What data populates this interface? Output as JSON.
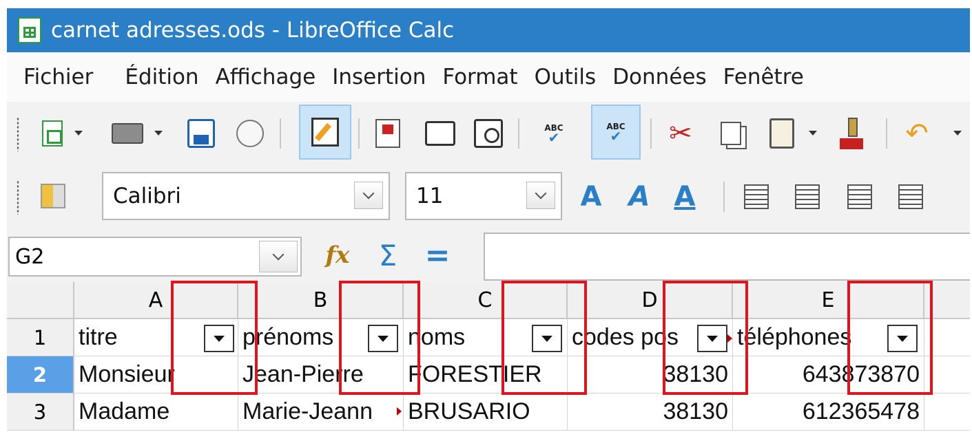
{
  "window": {
    "title": "carnet adresses.ods - LibreOffice Calc",
    "app_icon": "calc-document-icon"
  },
  "menu": [
    "Fichier",
    "Édition",
    "Affichage",
    "Insertion",
    "Format",
    "Outils",
    "Données",
    "Fenêtre"
  ],
  "standard_toolbar": {
    "icons": [
      "new-icon",
      "open-icon",
      "save-icon",
      "email-icon",
      "edit-mode-icon",
      "export-pdf-icon",
      "print-icon",
      "print-preview-icon",
      "spellcheck-icon",
      "autospellcheck-icon",
      "cut-icon",
      "copy-icon",
      "paste-icon",
      "clone-formatting-icon",
      "undo-icon"
    ]
  },
  "formatting_toolbar": {
    "font_name": "Calibri",
    "font_size": "11",
    "icons": [
      "styles-icon",
      "bold-icon",
      "italic-icon",
      "underline-icon",
      "align-left-icon",
      "align-center-icon",
      "align-right-icon",
      "justify-icon"
    ]
  },
  "formula_bar": {
    "cell_ref": "G2",
    "content": "",
    "icons": [
      "function-wizard-icon",
      "sum-icon",
      "equals-icon"
    ]
  },
  "sheet": {
    "columns": [
      "A",
      "B",
      "C",
      "D",
      "E"
    ],
    "rows": [
      {
        "num": "1",
        "cells": [
          "titre",
          "prénoms",
          "noms",
          "codes pos",
          "téléphones"
        ]
      },
      {
        "num": "2",
        "cells": [
          "Monsieur",
          "Jean-Pierre",
          "FORESTIER",
          "38130",
          "643873870"
        ]
      },
      {
        "num": "3",
        "cells": [
          "Madame",
          "Marie-Jeann",
          "BRUSARIO",
          "38130",
          "612365478"
        ]
      }
    ],
    "active_row": "2",
    "highlight_color": "#e0141c"
  }
}
